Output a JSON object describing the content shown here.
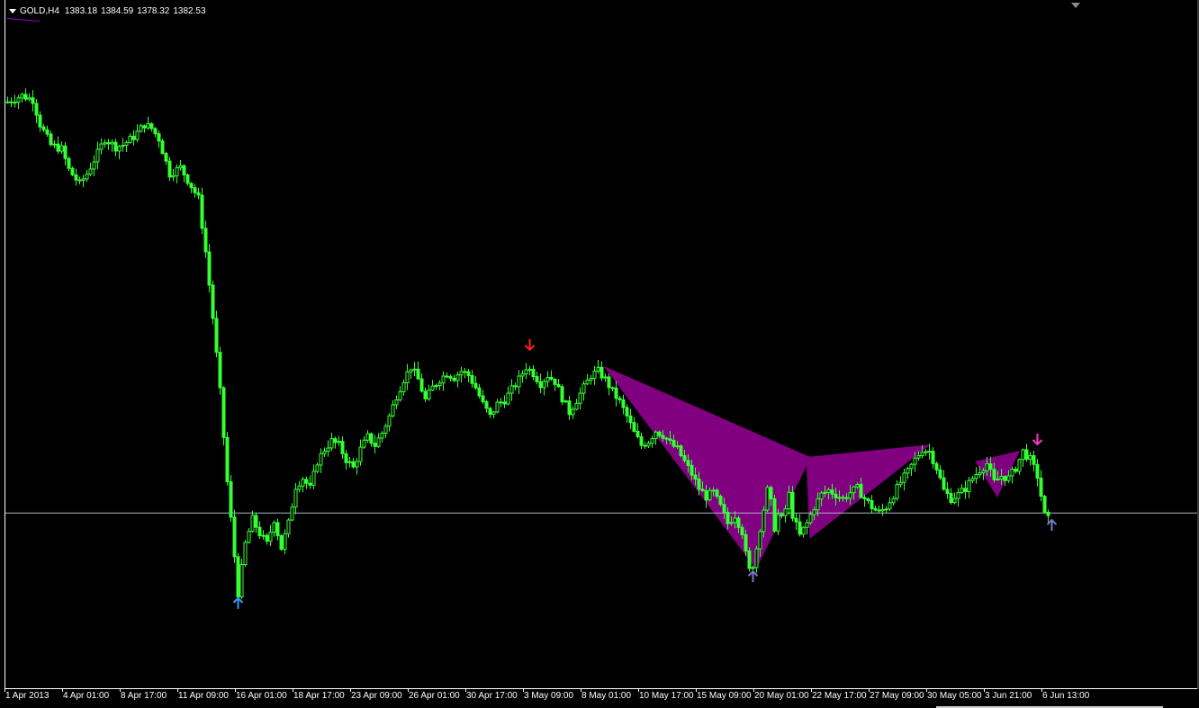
{
  "header": {
    "symbol": "GOLD,H4",
    "open": "1383.18",
    "high": "1384.59",
    "low": "1378.32",
    "close": "1382.53"
  },
  "colors": {
    "background": "#000000",
    "candle": "#33ff33",
    "pattern_fill": "#800080",
    "hline": "#a8b4c8",
    "arrow_down_red": "#ff2020",
    "arrow_down_magenta": "#ff33cc",
    "arrow_up_blue": "#3399ff",
    "arrow_up_slate": "#7777cc",
    "indicator_line": "#9900cc"
  },
  "chart_data": {
    "type": "candlestick",
    "xlabel": "",
    "ylabel": "",
    "grid": false,
    "x_ticks": [
      "1 Apr 2013",
      "4 Apr 01:00",
      "8 Apr 17:00",
      "11 Apr 09:00",
      "16 Apr 01:00",
      "18 Apr 17:00",
      "23 Apr 09:00",
      "26 Apr 01:00",
      "30 Apr 17:00",
      "3 May 09:00",
      "8 May 01:00",
      "10 May 17:00",
      "15 May 09:00",
      "20 May 01:00",
      "22 May 17:00",
      "27 May 09:00",
      "30 May 05:00",
      "3 Jun 21:00",
      "6 Jun 13:00"
    ],
    "x_tick_index": [
      0,
      16,
      32,
      48,
      64,
      80,
      96,
      112,
      128,
      144,
      160,
      176,
      192,
      208,
      224,
      240,
      256,
      272,
      288
    ],
    "ylim": [
      1310,
      1625
    ],
    "price_path": [
      [
        0,
        1593
      ],
      [
        4,
        1596
      ],
      [
        7,
        1594
      ],
      [
        9,
        1582
      ],
      [
        12,
        1572
      ],
      [
        15,
        1570
      ],
      [
        17,
        1560
      ],
      [
        20,
        1553
      ],
      [
        22,
        1558
      ],
      [
        25,
        1568
      ],
      [
        27,
        1575
      ],
      [
        30,
        1571
      ],
      [
        32,
        1572
      ],
      [
        35,
        1576
      ],
      [
        38,
        1582
      ],
      [
        40,
        1580
      ],
      [
        42,
        1575
      ],
      [
        45,
        1558
      ],
      [
        48,
        1561
      ],
      [
        50,
        1555
      ],
      [
        53,
        1546
      ],
      [
        55,
        1520
      ],
      [
        57,
        1488
      ],
      [
        59,
        1452
      ],
      [
        61,
        1408
      ],
      [
        63,
        1372
      ],
      [
        64,
        1354
      ],
      [
        66,
        1378
      ],
      [
        68,
        1390
      ],
      [
        70,
        1383
      ],
      [
        72,
        1378
      ],
      [
        74,
        1390
      ],
      [
        76,
        1376
      ],
      [
        78,
        1388
      ],
      [
        80,
        1406
      ],
      [
        82,
        1410
      ],
      [
        84,
        1405
      ],
      [
        86,
        1418
      ],
      [
        88,
        1424
      ],
      [
        90,
        1428
      ],
      [
        92,
        1426
      ],
      [
        94,
        1419
      ],
      [
        96,
        1415
      ],
      [
        98,
        1424
      ],
      [
        100,
        1430
      ],
      [
        102,
        1426
      ],
      [
        104,
        1432
      ],
      [
        106,
        1440
      ],
      [
        108,
        1450
      ],
      [
        110,
        1458
      ],
      [
        112,
        1464
      ],
      [
        114,
        1458
      ],
      [
        116,
        1448
      ],
      [
        118,
        1454
      ],
      [
        120,
        1458
      ],
      [
        122,
        1461
      ],
      [
        124,
        1459
      ],
      [
        126,
        1462
      ],
      [
        128,
        1460
      ],
      [
        130,
        1454
      ],
      [
        132,
        1446
      ],
      [
        134,
        1440
      ],
      [
        136,
        1446
      ],
      [
        138,
        1448
      ],
      [
        140,
        1453
      ],
      [
        142,
        1458
      ],
      [
        144,
        1464
      ],
      [
        146,
        1461
      ],
      [
        148,
        1456
      ],
      [
        150,
        1460
      ],
      [
        152,
        1457
      ],
      [
        154,
        1449
      ],
      [
        156,
        1442
      ],
      [
        158,
        1448
      ],
      [
        160,
        1454
      ],
      [
        162,
        1460
      ],
      [
        164,
        1462
      ],
      [
        166,
        1458
      ],
      [
        168,
        1452
      ],
      [
        170,
        1447
      ],
      [
        172,
        1440
      ],
      [
        174,
        1432
      ],
      [
        176,
        1426
      ],
      [
        178,
        1428
      ],
      [
        180,
        1433
      ],
      [
        182,
        1431
      ],
      [
        184,
        1427
      ],
      [
        186,
        1424
      ],
      [
        188,
        1418
      ],
      [
        190,
        1412
      ],
      [
        192,
        1405
      ],
      [
        194,
        1401
      ],
      [
        196,
        1403
      ],
      [
        198,
        1396
      ],
      [
        200,
        1388
      ],
      [
        202,
        1392
      ],
      [
        204,
        1384
      ],
      [
        205,
        1373
      ],
      [
        206,
        1365
      ],
      [
        207,
        1368
      ],
      [
        208,
        1376
      ],
      [
        209,
        1386
      ],
      [
        210,
        1395
      ],
      [
        211,
        1404
      ],
      [
        212,
        1398
      ],
      [
        213,
        1386
      ],
      [
        214,
        1392
      ],
      [
        215,
        1390
      ],
      [
        216,
        1395
      ],
      [
        217,
        1402
      ],
      [
        218,
        1392
      ],
      [
        220,
        1382
      ],
      [
        222,
        1388
      ],
      [
        224,
        1396
      ],
      [
        226,
        1402
      ],
      [
        228,
        1404
      ],
      [
        230,
        1402
      ],
      [
        232,
        1400
      ],
      [
        234,
        1403
      ],
      [
        236,
        1405
      ],
      [
        238,
        1400
      ],
      [
        240,
        1396
      ],
      [
        242,
        1393
      ],
      [
        244,
        1396
      ],
      [
        246,
        1402
      ],
      [
        248,
        1408
      ],
      [
        250,
        1413
      ],
      [
        252,
        1419
      ],
      [
        254,
        1424
      ],
      [
        256,
        1423
      ],
      [
        258,
        1415
      ],
      [
        260,
        1404
      ],
      [
        262,
        1400
      ],
      [
        264,
        1402
      ],
      [
        266,
        1405
      ],
      [
        268,
        1410
      ],
      [
        270,
        1414
      ],
      [
        272,
        1417
      ],
      [
        274,
        1408
      ],
      [
        276,
        1411
      ],
      [
        278,
        1410
      ],
      [
        280,
        1415
      ],
      [
        282,
        1423
      ],
      [
        284,
        1419
      ],
      [
        286,
        1411
      ],
      [
        288,
        1392
      ],
      [
        289,
        1390
      ]
    ],
    "x_max_index": 300,
    "horizontal_line": 1393,
    "patterns": [
      {
        "points": [
          [
            166,
            1464
          ],
          [
            208,
            1366
          ],
          [
            223,
            1420
          ]
        ]
      },
      {
        "points": [
          [
            222,
            1420
          ],
          [
            223,
            1381
          ],
          [
            256,
            1426
          ]
        ]
      },
      {
        "points": [
          [
            269,
            1418
          ],
          [
            275,
            1401
          ],
          [
            281,
            1423
          ]
        ]
      }
    ],
    "arrows": [
      {
        "index": 64,
        "price": 1349,
        "dir": "up",
        "color": "#3399ff"
      },
      {
        "index": 145,
        "price": 1475,
        "dir": "down",
        "color": "#ff2020"
      },
      {
        "index": 207,
        "price": 1362,
        "dir": "up",
        "color": "#7777cc"
      },
      {
        "index": 286,
        "price": 1429,
        "dir": "down",
        "color": "#ff33cc"
      },
      {
        "index": 290,
        "price": 1387,
        "dir": "up",
        "color": "#7777cc"
      }
    ]
  }
}
